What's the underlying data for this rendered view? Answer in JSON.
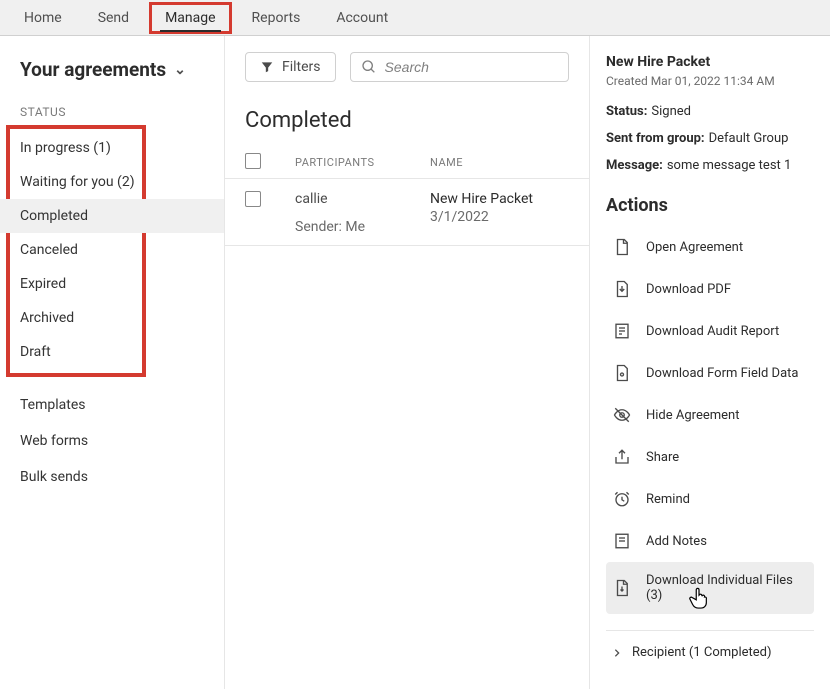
{
  "nav": {
    "items": [
      "Home",
      "Send",
      "Manage",
      "Reports",
      "Account"
    ],
    "active": 2,
    "highlighted": 2
  },
  "sidebar": {
    "title": "Your agreements",
    "statusHeader": "STATUS",
    "statusItems": [
      {
        "label": "In progress (1)"
      },
      {
        "label": "Waiting for you (2)"
      },
      {
        "label": "Completed",
        "selected": true
      },
      {
        "label": "Canceled"
      },
      {
        "label": "Expired"
      },
      {
        "label": "Archived"
      },
      {
        "label": "Draft"
      }
    ],
    "otherItems": [
      "Templates",
      "Web forms",
      "Bulk sends"
    ]
  },
  "toolbar": {
    "filtersLabel": "Filters",
    "searchPlaceholder": "Search"
  },
  "content": {
    "title": "Completed",
    "columns": {
      "participants": "PARTICIPANTS",
      "name": "NAME"
    },
    "rows": [
      {
        "participant": "callie",
        "sender": "Sender: Me",
        "name": "New Hire Packet",
        "date": "3/1/2022"
      }
    ]
  },
  "details": {
    "title": "New Hire Packet",
    "created": "Created Mar 01, 2022 11:34 AM",
    "meta": [
      {
        "label": "Status:",
        "value": "Signed"
      },
      {
        "label": "Sent from group:",
        "value": "Default Group"
      },
      {
        "label": "Message:",
        "value": "some message test 1"
      }
    ],
    "actionsHeader": "Actions",
    "actions": [
      "Open Agreement",
      "Download PDF",
      "Download Audit Report",
      "Download Form Field Data",
      "Hide Agreement",
      "Share",
      "Remind",
      "Add Notes",
      "Download Individual Files (3)"
    ],
    "recipient": "Recipient (1 Completed)"
  }
}
